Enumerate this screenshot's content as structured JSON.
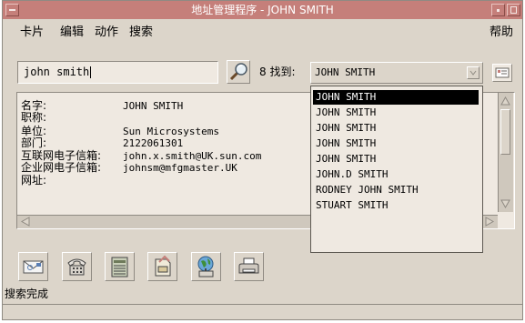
{
  "window": {
    "title": "地址管理程序 - JOHN SMITH"
  },
  "menubar": {
    "items": [
      "卡片",
      "编辑",
      "动作",
      "搜索"
    ],
    "help": "帮助"
  },
  "search": {
    "value": "john smith",
    "found_label": "8 找到:",
    "combo_value": "JOHN SMITH"
  },
  "card": {
    "fields": [
      {
        "label": "名字:",
        "value": "JOHN SMITH"
      },
      {
        "label": "职称:",
        "value": ""
      },
      {
        "label": "单位:",
        "value": "Sun Microsystems"
      },
      {
        "label": "部门:",
        "value": "2122061301"
      },
      {
        "label": "互联网电子信箱:",
        "value": "john.x.smith@UK.sun.com"
      },
      {
        "label": "企业网电子信箱:",
        "value": "johnsm@mfgmaster.UK"
      },
      {
        "label": "网址:",
        "value": ""
      }
    ]
  },
  "results": {
    "items": [
      "JOHN SMITH",
      "JOHN SMITH",
      "JOHN SMITH",
      "JOHN SMITH",
      "JOHN SMITH",
      "JOHN.D SMITH",
      "RODNEY JOHN SMITH",
      "STUART SMITH"
    ],
    "selected_index": 0
  },
  "toolbar": {
    "icons": [
      "mail-icon",
      "phone-icon",
      "calendar-icon",
      "card-icon",
      "globe-icon",
      "printer-icon"
    ]
  },
  "status": {
    "text": "搜索完成"
  },
  "colors": {
    "titlebar": "#c57f7a",
    "window_bg": "#dcd5ca",
    "field_bg": "#efe9e1",
    "selection": "#000000"
  }
}
